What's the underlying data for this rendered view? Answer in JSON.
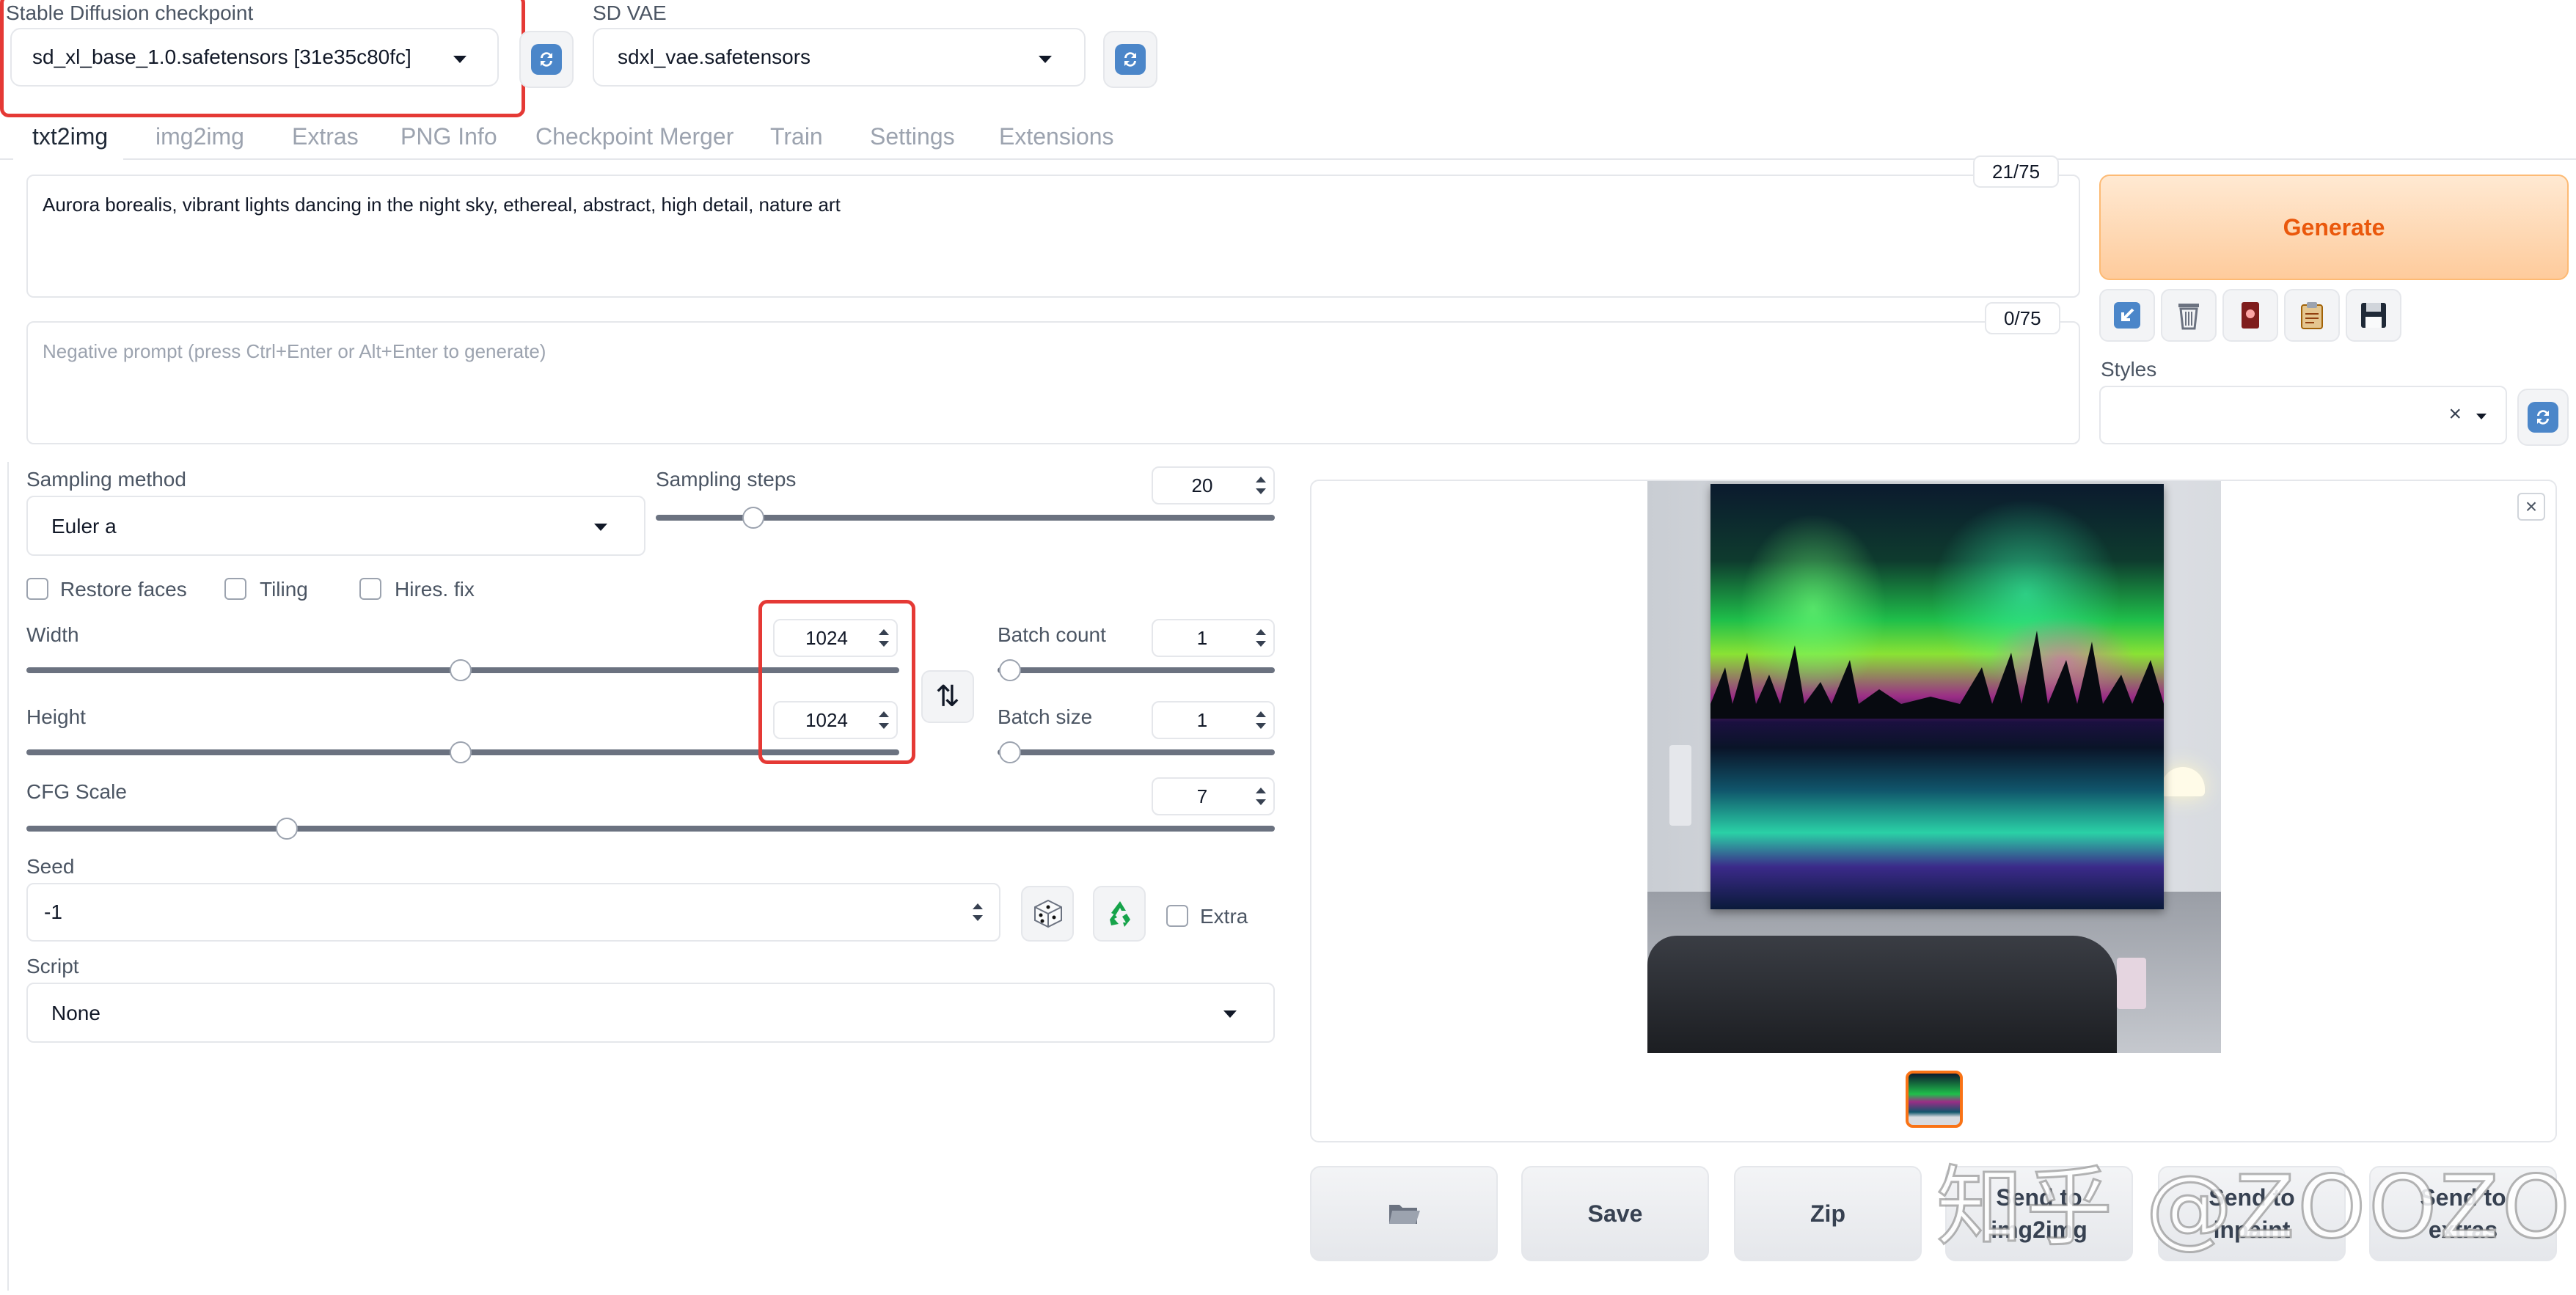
{
  "top": {
    "checkpoint_label": "Stable Diffusion checkpoint",
    "checkpoint_value": "sd_xl_base_1.0.safetensors [31e35c80fc]",
    "vae_label": "SD VAE",
    "vae_value": "sdxl_vae.safetensors"
  },
  "tabs": [
    "txt2img",
    "img2img",
    "Extras",
    "PNG Info",
    "Checkpoint Merger",
    "Train",
    "Settings",
    "Extensions"
  ],
  "prompt": {
    "text": "Aurora borealis, vibrant lights dancing in the night sky, ethereal, abstract, high detail, nature art",
    "token_count": "21/75"
  },
  "negative": {
    "placeholder": "Negative prompt (press Ctrl+Enter or Alt+Enter to generate)",
    "token_count": "0/75"
  },
  "generate_label": "Generate",
  "styles_label": "Styles",
  "styles_clear": "×",
  "sampling": {
    "method_label": "Sampling method",
    "method_value": "Euler a",
    "steps_label": "Sampling steps",
    "steps_value": "20"
  },
  "checks": {
    "restore_faces": "Restore faces",
    "tiling": "Tiling",
    "hires_fix": "Hires. fix"
  },
  "size": {
    "width_label": "Width",
    "width_value": "1024",
    "height_label": "Height",
    "height_value": "1024",
    "swap_icon": "⇅"
  },
  "batch": {
    "count_label": "Batch count",
    "count_value": "1",
    "size_label": "Batch size",
    "size_value": "1"
  },
  "cfg": {
    "label": "CFG Scale",
    "value": "7"
  },
  "seed": {
    "label": "Seed",
    "value": "-1",
    "extra_label": "Extra"
  },
  "script": {
    "label": "Script",
    "value": "None"
  },
  "slider_levels": {
    "sampling_steps": 0.14,
    "width": 0.5,
    "height": 0.5,
    "batch_count": 0.0,
    "batch_size": 0.0,
    "cfg_scale": 0.2
  },
  "output_buttons": {
    "folder_icon": "folder-icon",
    "save": "Save",
    "zip": "Zip",
    "send_img2img": "Send to img2img",
    "send_inpaint": "Send to inpaint",
    "send_extras": "Send to extras"
  },
  "watermark": "知乎 @ZOOZOO",
  "colors": {
    "highlight_red": "#e53935",
    "generate_text": "#ea580c",
    "generate_bg": "#fed7aa"
  }
}
